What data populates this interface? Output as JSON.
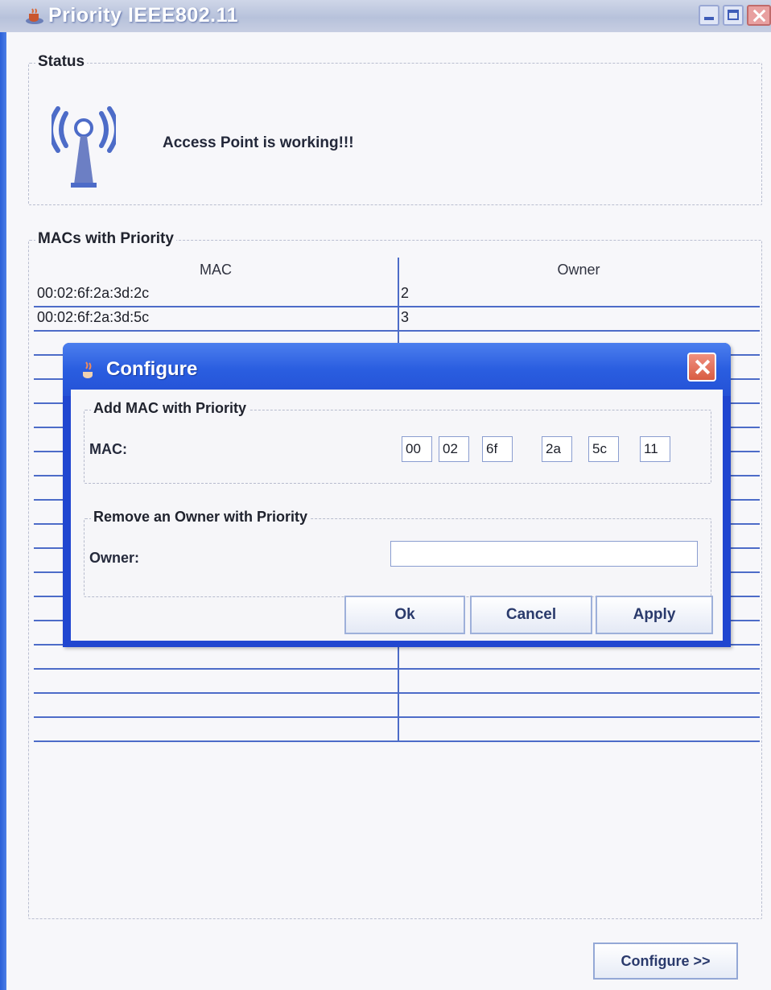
{
  "window": {
    "title": "Priority IEEE802.11"
  },
  "status": {
    "group_title": "Status",
    "icon": "wireless-antenna-icon",
    "message": "Access Point is working!!!"
  },
  "macs": {
    "group_title": "MACs with Priority",
    "columns": [
      "MAC",
      "Owner"
    ],
    "rows": [
      {
        "mac": "00:02:6f:2a:3d:2c",
        "owner": "2"
      },
      {
        "mac": "00:02:6f:2a:3d:5c",
        "owner": "3"
      },
      {
        "mac": "",
        "owner": ""
      },
      {
        "mac": "",
        "owner": ""
      },
      {
        "mac": "",
        "owner": ""
      },
      {
        "mac": "",
        "owner": ""
      },
      {
        "mac": "",
        "owner": ""
      },
      {
        "mac": "",
        "owner": ""
      },
      {
        "mac": "",
        "owner": ""
      },
      {
        "mac": "",
        "owner": ""
      },
      {
        "mac": "",
        "owner": ""
      },
      {
        "mac": "",
        "owner": ""
      },
      {
        "mac": "",
        "owner": ""
      },
      {
        "mac": "",
        "owner": ""
      },
      {
        "mac": "",
        "owner": ""
      },
      {
        "mac": "",
        "owner": ""
      },
      {
        "mac": "",
        "owner": ""
      },
      {
        "mac": "",
        "owner": ""
      },
      {
        "mac": "",
        "owner": ""
      }
    ]
  },
  "configure_button": "Configure >>",
  "dialog": {
    "title": "Configure",
    "add_group_title": "Add MAC with Priority",
    "mac_label": "MAC:",
    "mac_octets": [
      "00",
      "02",
      "6f",
      "2a",
      "5c",
      "11"
    ],
    "remove_group_title": "Remove an Owner with Priority",
    "owner_label": "Owner:",
    "owner_value": "",
    "buttons": {
      "ok": "Ok",
      "cancel": "Cancel",
      "apply": "Apply"
    }
  },
  "colors": {
    "title_blue": "#2451d6",
    "grid_line": "#4d6cc8",
    "close_red": "#d85c42"
  }
}
